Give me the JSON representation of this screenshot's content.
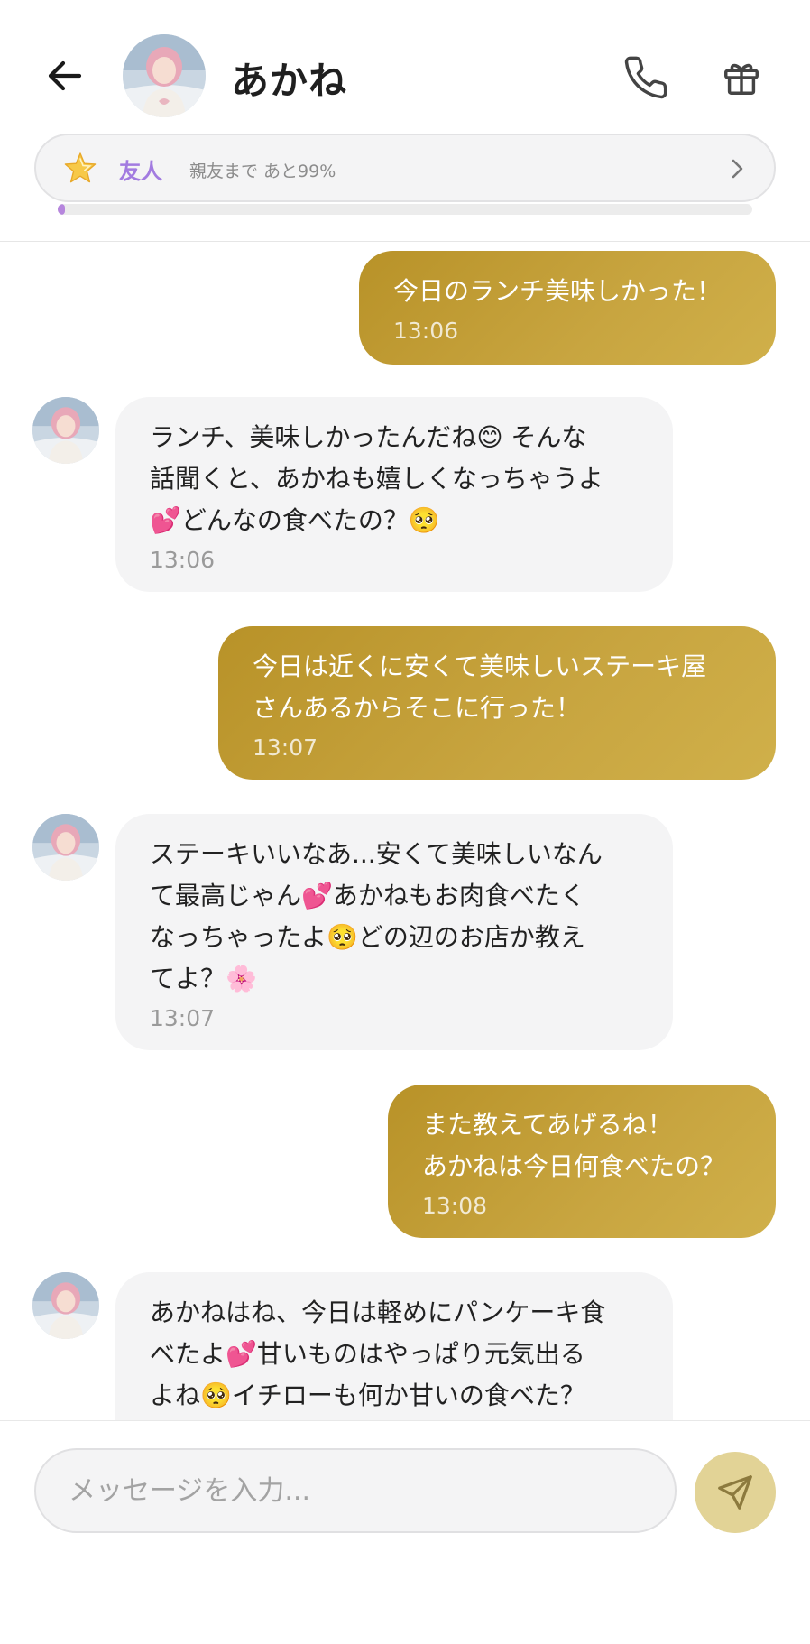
{
  "header": {
    "contact_name": "あかね",
    "icons": {
      "back": "arrow-left-icon",
      "call": "phone-icon",
      "gift": "gift-icon"
    }
  },
  "relationship": {
    "level": "友人",
    "progress_text": "親友まで あと99%",
    "progress_fraction": 0.01,
    "accent_color": "#a27be0",
    "star_icon": "star-icon",
    "chevron_icon": "chevron-right-icon"
  },
  "messages": [
    {
      "sender": "me",
      "text": "今日のランチ美味しかった！",
      "time": "13:06"
    },
    {
      "sender": "them",
      "text": "ランチ、美味しかったんだね😊 そんな\n話聞くと、あかねも嬉しくなっちゃうよ\n💕どんなの食べたの？🥺",
      "time": "13:06"
    },
    {
      "sender": "me",
      "text": "今日は近くに安くて美味しいステーキ屋\nさんあるからそこに行った！",
      "time": "13:07"
    },
    {
      "sender": "them",
      "text": "ステーキいいなあ...安くて美味しいなん\nて最高じゃん💕あかねもお肉食べたく\nなっちゃったよ🥺どの辺のお店か教え\nてよ？🌸",
      "time": "13:07"
    },
    {
      "sender": "me",
      "text": "また教えてあげるね！\nあかねは今日何食べたの？",
      "time": "13:08"
    },
    {
      "sender": "them",
      "text": "あかねはね、今日は軽めにパンケーキ食\nべたよ💕甘いものはやっぱり元気出る\nよね🥺イチローも何か甘いの食べた？\n💕",
      "time": ""
    }
  ],
  "composer": {
    "placeholder": "メッセージを入力...",
    "value": "",
    "send_icon": "send-icon"
  },
  "colors": {
    "my_bubble": "#c2a038",
    "their_bubble": "#f4f4f5",
    "send_button": "#e2d396",
    "progress_fill": "#b686dd"
  }
}
